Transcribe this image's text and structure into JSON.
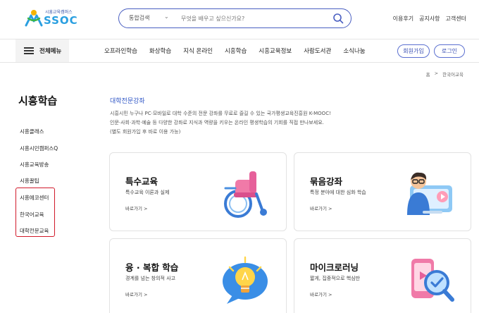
{
  "header": {
    "logo_small": "시흥교육캠퍼스",
    "logo_big": "SSOC",
    "search_category": "통합검색",
    "search_placeholder": "무엇을 배우고 싶으신가요?",
    "links": [
      "이용후기",
      "공지사항",
      "고객센터"
    ]
  },
  "nav": {
    "all_menu_label": "전체메뉴",
    "items": [
      "오프라인학습",
      "화상학습",
      "지식 온라인",
      "시흥학습",
      "시흥교육정보",
      "사람도서관",
      "소식나눔"
    ],
    "signup_label": "회원가입",
    "login_label": "로그인"
  },
  "breadcrumb": {
    "home": "홈",
    "separator": ">",
    "current": "한국어교육"
  },
  "sidebar": {
    "title": "시흥학습",
    "items": [
      "시흥클래스",
      "시흥시민캠퍼스Q",
      "시흥교육방송",
      "시흥꿀팁",
      "시흥에코센터",
      "한국어교육",
      "대학전문교육"
    ],
    "highlight_color": "#d11a2a"
  },
  "main": {
    "section_title": "대학전문강좌",
    "description": [
      "시흥시민 누구나 PC·모바일로 대학 수준의 전문 강좌를 무료로 즐길 수 있는 국가평생교육진흥원 K-MOOC!",
      "인문·사회·과학·예술 등 다양한 강좌로 지식과 역량을 키우는 온라인 평생학습의 기회를 직접 만나보세요.",
      "(별도 회원가입 후 바로 이용 가능)"
    ],
    "cards": [
      {
        "title": "특수교육",
        "subtitle": "특수교육 이론과 실제",
        "link": "바로가기 >",
        "icon": "wheelchair-icon"
      },
      {
        "title": "묶음강좌",
        "subtitle": "특정 분야에 대한 심화 학습",
        "link": "바로가기 >",
        "icon": "online-teacher-icon"
      },
      {
        "title": "융 · 복합 학습",
        "subtitle": "경계를 넘는 창의적 사고",
        "link": "바로가기 >",
        "icon": "lightbulb-icon"
      },
      {
        "title": "마이크로러닝",
        "subtitle": "짧게, 집중적으로 핵심만",
        "link": "바로가기 >",
        "icon": "video-magnifier-icon"
      }
    ]
  },
  "colors": {
    "accent": "#2f56c6",
    "logo_blue": "#2a9fe0",
    "border_blue": "#4a5fc1"
  }
}
